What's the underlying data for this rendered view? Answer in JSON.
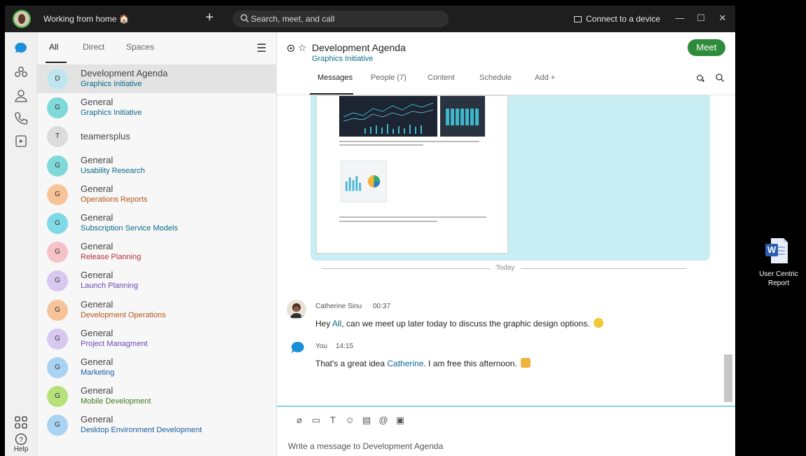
{
  "titlebar": {
    "status": "Working from home 🏠",
    "search_placeholder": "Search, meet, and call",
    "connect_device": "Connect to a device"
  },
  "navrail": {
    "help_label": "Help"
  },
  "spacelist": {
    "tabs": [
      {
        "label": "All"
      },
      {
        "label": "Direct"
      },
      {
        "label": "Spaces"
      }
    ],
    "spaces": [
      {
        "initial": "D",
        "title": "Development Agenda",
        "subtitle": "Graphics Initiative",
        "avatar_color": "#bfe6ef",
        "sub_color": "#0a6a8a"
      },
      {
        "initial": "G",
        "title": "General",
        "subtitle": "Graphics Initiative",
        "avatar_color": "#7fd9d8",
        "sub_color": "#0a6a8a"
      },
      {
        "initial": "T",
        "title": "teamersplus",
        "subtitle": "",
        "avatar_color": "#dcdcdc",
        "sub_color": "#0a6a8a"
      },
      {
        "initial": "G",
        "title": "General",
        "subtitle": "Usability Research",
        "avatar_color": "#7fd9d8",
        "sub_color": "#0a6a8a"
      },
      {
        "initial": "G",
        "title": "General",
        "subtitle": "Operations Reports",
        "avatar_color": "#f7c49a",
        "sub_color": "#b5561a"
      },
      {
        "initial": "G",
        "title": "General",
        "subtitle": "Subscription Service Models",
        "avatar_color": "#7fd9e6",
        "sub_color": "#0a6a8a"
      },
      {
        "initial": "G",
        "title": "General",
        "subtitle": "Release Planning",
        "avatar_color": "#f5c2c8",
        "sub_color": "#b5303e"
      },
      {
        "initial": "G",
        "title": "General",
        "subtitle": "Launch Planning",
        "avatar_color": "#d7c8f0",
        "sub_color": "#6a4bb5"
      },
      {
        "initial": "G",
        "title": "General",
        "subtitle": "Development Operations",
        "avatar_color": "#f7c49a",
        "sub_color": "#b5561a"
      },
      {
        "initial": "G",
        "title": "General",
        "subtitle": "Project Managment",
        "avatar_color": "#d7c8f0",
        "sub_color": "#6a4bb5"
      },
      {
        "initial": "G",
        "title": "General",
        "subtitle": "Marketing",
        "avatar_color": "#a9d3f2",
        "sub_color": "#1a5fa0"
      },
      {
        "initial": "G",
        "title": "General",
        "subtitle": "Mobile Development",
        "avatar_color": "#b6e07a",
        "sub_color": "#3d7a1a"
      },
      {
        "initial": "G",
        "title": "General",
        "subtitle": "Desktop Environment Development",
        "avatar_color": "#a9d3f2",
        "sub_color": "#1a5fa0"
      }
    ]
  },
  "conversation": {
    "title": "Development Agenda",
    "subtitle": "Graphics Initiative",
    "meet_label": "Meet",
    "tabs": [
      {
        "label": "Messages"
      },
      {
        "label": "People (7)"
      },
      {
        "label": "Content"
      },
      {
        "label": "Schedule"
      },
      {
        "label": "Add +"
      }
    ],
    "day_divider": "Today",
    "messages": [
      {
        "author": "Catherine Sinu",
        "time": "00:37",
        "text_before": "Hey ",
        "mention": "All",
        "text_after": ", can we meet up later today to discuss the graphic design options."
      },
      {
        "author": "You",
        "time": "14:15",
        "text_before": "That's a great idea ",
        "mention": "Catherine",
        "text_after": ". I am free this afternoon."
      }
    ],
    "composer_placeholder": "Write a message to Development Agenda"
  },
  "desktop": {
    "icon_label_line1": "User Centric",
    "icon_label_line2": "Report"
  },
  "colors": {
    "accent_green": "#2e8b3b",
    "link_teal": "#0a6a8a",
    "card_bg": "#c8eef4"
  }
}
